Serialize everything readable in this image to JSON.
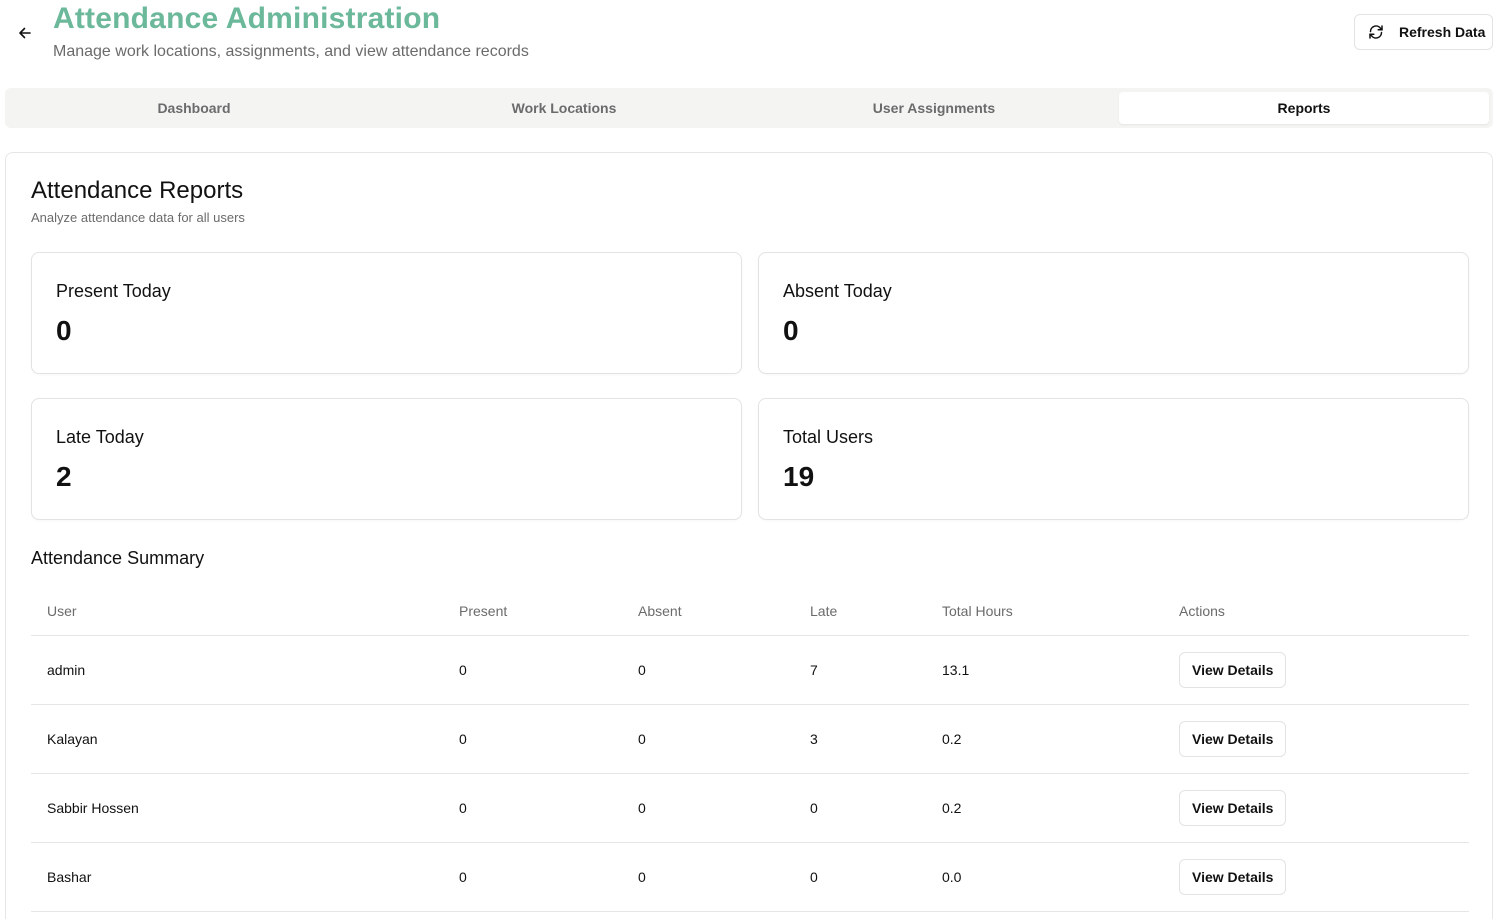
{
  "header": {
    "title": "Attendance Administration",
    "subtitle": "Manage work locations, assignments, and view attendance records",
    "back_icon": "arrow-left-icon",
    "refresh_label": "Refresh Data",
    "refresh_icon": "refresh-icon",
    "title_color": "#6bb89a"
  },
  "tabs": [
    {
      "label": "Dashboard",
      "active": false
    },
    {
      "label": "Work Locations",
      "active": false
    },
    {
      "label": "User Assignments",
      "active": false
    },
    {
      "label": "Reports",
      "active": true
    }
  ],
  "reports": {
    "title": "Attendance Reports",
    "description": "Analyze attendance data for all users",
    "stats": [
      {
        "label": "Present Today",
        "value": "0"
      },
      {
        "label": "Absent Today",
        "value": "0"
      },
      {
        "label": "Late Today",
        "value": "2"
      },
      {
        "label": "Total Users",
        "value": "19"
      }
    ],
    "summary_title": "Attendance Summary",
    "columns": [
      "User",
      "Present",
      "Absent",
      "Late",
      "Total Hours",
      "Actions"
    ],
    "rows": [
      {
        "user": "admin",
        "present": "0",
        "absent": "0",
        "late": "7",
        "hours": "13.1",
        "action": "View Details"
      },
      {
        "user": "Kalayan",
        "present": "0",
        "absent": "0",
        "late": "3",
        "hours": "0.2",
        "action": "View Details"
      },
      {
        "user": "Sabbir Hossen",
        "present": "0",
        "absent": "0",
        "late": "0",
        "hours": "0.2",
        "action": "View Details"
      },
      {
        "user": "Bashar",
        "present": "0",
        "absent": "0",
        "late": "0",
        "hours": "0.0",
        "action": "View Details"
      }
    ]
  }
}
